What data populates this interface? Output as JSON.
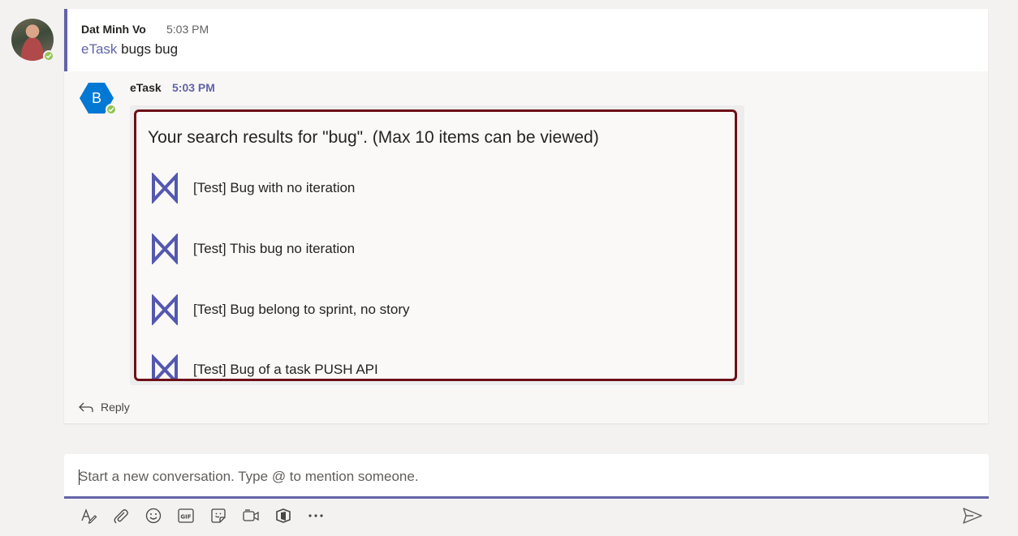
{
  "thread": {
    "sender": "Dat Minh Vo",
    "time": "5:03 PM",
    "mention": "eTask",
    "message": " bugs bug"
  },
  "bot": {
    "initial": "B",
    "name": "eTask",
    "time": "5:03 PM",
    "card_title": "Your search results for \"bug\". (Max 10 items can be viewed)",
    "results": [
      {
        "label": "[Test] Bug with no iteration"
      },
      {
        "label": "[Test] This bug no iteration"
      },
      {
        "label": "[Test] Bug belong to sprint, no story"
      },
      {
        "label": "[Test] Bug of a task PUSH API"
      }
    ]
  },
  "reply_label": "Reply",
  "compose": {
    "placeholder": "Start a new conversation. Type @ to mention someone."
  },
  "toolbar": {
    "icons": [
      "format-icon",
      "attach-icon",
      "emoji-icon",
      "gif-icon",
      "sticker-icon",
      "meet-now-icon",
      "app-icon",
      "more-options-icon"
    ]
  },
  "colors": {
    "accent": "#6264a7",
    "presence": "#92c353",
    "card_border": "#6e0f18",
    "bot_avatar": "#0078d4"
  }
}
